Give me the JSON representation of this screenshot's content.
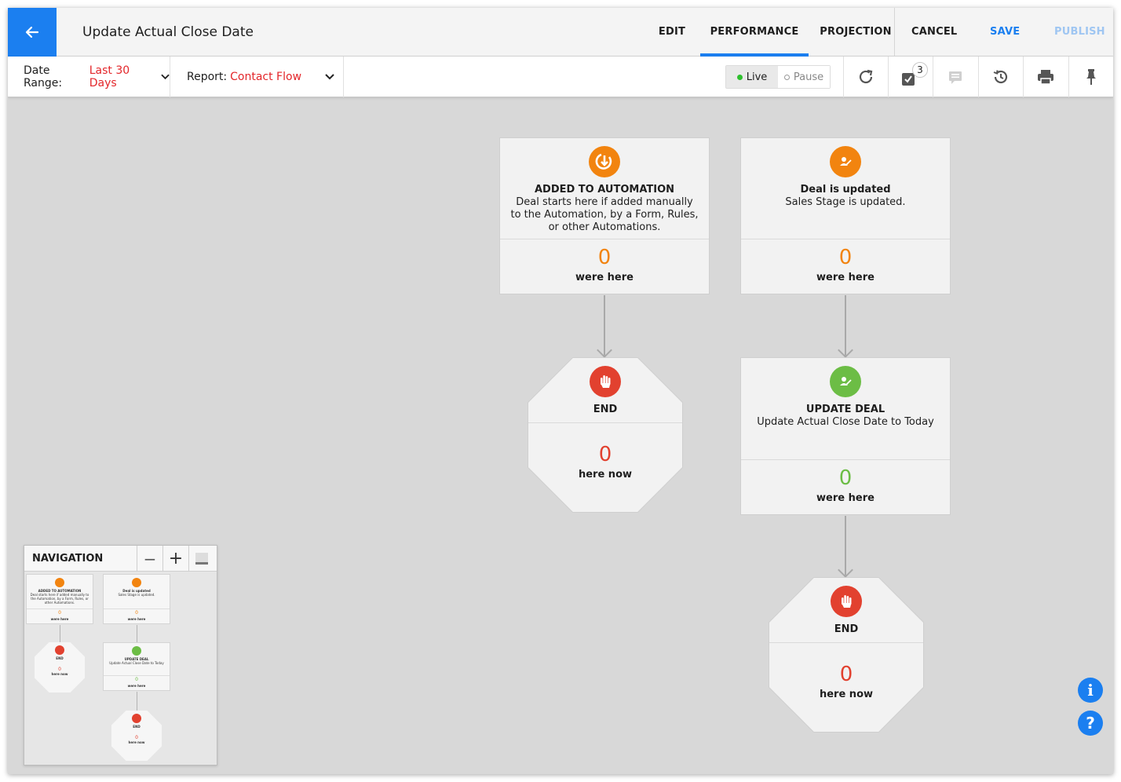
{
  "header": {
    "title": "Update Actual Close Date",
    "tabs": [
      {
        "label": "EDIT"
      },
      {
        "label": "PERFORMANCE"
      },
      {
        "label": "PROJECTION"
      }
    ],
    "actions": {
      "cancel": "CANCEL",
      "save": "SAVE",
      "publish": "PUBLISH"
    }
  },
  "toolbar": {
    "date_range_label": "Date Range:",
    "date_range_value": "Last 30 Days",
    "report_label": "Report:",
    "report_value": "Contact Flow",
    "live": "Live",
    "pause": "Pause",
    "tasks_badge": "3"
  },
  "flow": {
    "trigger1": {
      "title": "ADDED TO AUTOMATION",
      "desc": "Deal starts here if added manually to the Automation, by a Form, Rules, or other Automations.",
      "count": "0",
      "count_label": "were here"
    },
    "trigger2": {
      "title": "Deal is updated",
      "desc": "Sales Stage is updated.",
      "count": "0",
      "count_label": "were here"
    },
    "end1": {
      "title": "END",
      "count": "0",
      "count_label": "here now"
    },
    "action1": {
      "title": "UPDATE DEAL",
      "desc": "Update Actual Close Date to Today",
      "count": "0",
      "count_label": "were here"
    },
    "end2": {
      "title": "END",
      "count": "0",
      "count_label": "here now"
    }
  },
  "navigation": {
    "title": "NAVIGATION",
    "minus": "−",
    "plus": "+"
  },
  "help": {
    "info": "i",
    "question": "?"
  },
  "colors": {
    "accent": "#1b7ff0",
    "orange": "#f2840f",
    "green": "#6cbd45",
    "red": "#e2412f",
    "link_red": "#e3262a",
    "publish_disabled": "#9fc6f2"
  }
}
